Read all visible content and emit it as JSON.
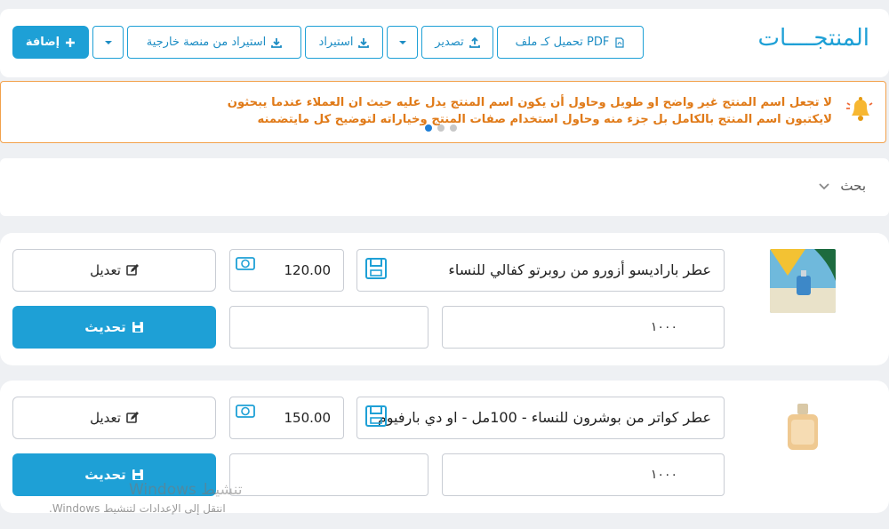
{
  "header": {
    "title": "المنتجــــات",
    "buttons": {
      "add": "إضافة",
      "import_external": "استيراد من منصة خارجية",
      "import": "استيراد",
      "export": "تصدير",
      "download_pdf": "تحميل كـ ملف PDF"
    }
  },
  "tip": {
    "text": "لا تجعل اسم المنتج غير واضح او طويل وحاول أن يكون اسم المنتج يدل عليه حيث ان العملاء عندما يبحثون لايكتبون اسم المنتج بالكامل بل جزء منه وحاول استخدام صفات المنتج وخياراته لتوضيح كل مايتضمنه",
    "active_slide": 1,
    "slide_count": 3
  },
  "search": {
    "label": "بحث"
  },
  "products": [
    {
      "name": "عطر باراديسو أزورو من روبرتو كفالي للنساء",
      "price": "120.00",
      "quantity": "١٠٠٠",
      "edit_label": "تعديل",
      "update_label": "تحديث"
    },
    {
      "name": "عطر كواتر من بوشرون للنساء - 100مل - او دي بارفيوم",
      "price": "150.00",
      "quantity": "١٠٠٠",
      "edit_label": "تعديل",
      "update_label": "تحديث"
    }
  ],
  "watermark": {
    "title": "تنشيط Windows",
    "subtitle": "انتقل إلى الإعدادات لتنشيط Windows."
  },
  "colors": {
    "accent": "#1ea0d6",
    "tip_border": "#f2a14b",
    "tip_text": "#e07a18"
  },
  "icons": [
    "plus-icon",
    "download-icon",
    "upload-icon",
    "chevron-down-icon",
    "pdf-icon",
    "bell-icon",
    "save-icon",
    "money-icon",
    "edit-icon",
    "floppy-icon"
  ]
}
